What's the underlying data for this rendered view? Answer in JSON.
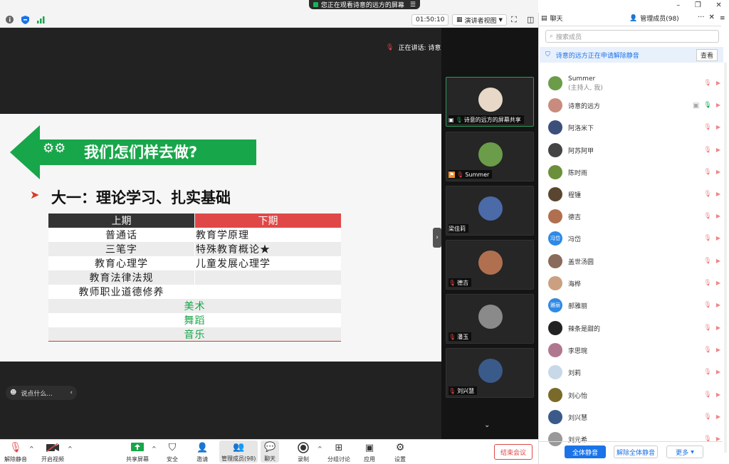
{
  "watch_banner": "您正在观看诗意的远方的屏幕",
  "toolbar": {
    "time": "01:50:10",
    "view_label": "演讲者视图"
  },
  "speaking": "正在讲话: 诗意的远方;",
  "slide": {
    "title": "我们怎们样去做?",
    "subtitle": "大一：理论学习、扎实基础",
    "col1": "上期",
    "col2": "下期",
    "rows": [
      [
        "普通话",
        "教育学原理"
      ],
      [
        "三笔字",
        "特殊教育概论★"
      ],
      [
        "教育心理学",
        "儿童发展心理学"
      ],
      [
        "教育法律法规",
        ""
      ],
      [
        "教师职业道德修养",
        ""
      ]
    ],
    "green_rows": [
      "美术",
      "舞蹈",
      "音乐"
    ]
  },
  "chat_input": "说点什么...",
  "gallery": [
    {
      "name": "诗意的远方的屏幕共享"
    },
    {
      "name": "Summer"
    },
    {
      "name": "梁佳莉"
    },
    {
      "name": "德吉"
    },
    {
      "name": "潘玉"
    },
    {
      "name": "刘兴慧"
    }
  ],
  "bottom": {
    "mute": "解除静音",
    "video": "开启视频",
    "share": "共享屏幕",
    "security": "安全",
    "invite": "邀请",
    "members": "管理成员(98)",
    "chat": "聊天",
    "record": "录制",
    "breakout": "分组讨论",
    "apps": "应用",
    "settings": "设置",
    "end": "结束会议"
  },
  "right": {
    "tab_chat": "聊天",
    "tab_members": "管理成员(98)",
    "search": "搜索成员",
    "notice": "诗意的远方正在申请解除静音",
    "notice_btn": "查看",
    "members": [
      {
        "name": "Summer",
        "sub": "(主持人, 我)",
        "color": "#6b9c4a"
      },
      {
        "name": "诗意的远方",
        "color": "#c98b7d"
      },
      {
        "name": "阿洛米下",
        "color": "#3b4f7a"
      },
      {
        "name": "阿苏阿甲",
        "color": "#444"
      },
      {
        "name": "陈时雨",
        "color": "#6b8f3a"
      },
      {
        "name": "程锺",
        "color": "#5a4630"
      },
      {
        "name": "德吉",
        "color": "#b07050"
      },
      {
        "name": "冯岱",
        "color": "#2e8ae6",
        "initials": "冯岱"
      },
      {
        "name": "盖世汤圆",
        "color": "#8a6a5a"
      },
      {
        "name": "海桦",
        "color": "#caa080"
      },
      {
        "name": "郝雅丽",
        "color": "#2e8ae6",
        "initials": "雅丽"
      },
      {
        "name": "辣条是甜的",
        "color": "#222"
      },
      {
        "name": "李思琬",
        "color": "#b07890"
      },
      {
        "name": "刘莉",
        "color": "#c8d8e8"
      },
      {
        "name": "刘心怡",
        "color": "#7a6a2a"
      },
      {
        "name": "刘兴慧",
        "color": "#3a5a8a"
      },
      {
        "name": "刘元希",
        "color": "#999"
      }
    ],
    "mute_all": "全体静音",
    "unmute_all": "解除全体静音",
    "more": "更多"
  },
  "colors": {
    "accent": "#1a73e8",
    "green": "#18a64a",
    "red": "#e04848"
  }
}
